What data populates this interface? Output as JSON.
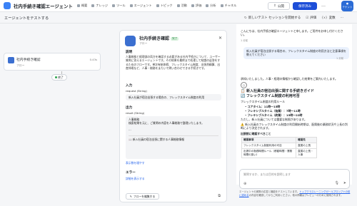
{
  "app": {
    "title": "社内手続き確認エージェント",
    "avatar_text": "テナント"
  },
  "nav": [
    "概要",
    "ナレッジ",
    "ツール",
    "エージェント",
    "トピック",
    "活動",
    "評価",
    "分析",
    "チャネル"
  ],
  "header": {
    "public_label": "公開",
    "save_label": "保存済み",
    "more": "…"
  },
  "subbar": {
    "title": "エージェントをテストする",
    "new_session": "新しいテスト セッションを開始する",
    "evaluate": "評価",
    "variables": "変数",
    "more": "…"
  },
  "flow_node": {
    "title": "社内手続き確認",
    "subtitle": "フロー",
    "time": "0.43s",
    "end_label": "終了"
  },
  "detail": {
    "title": "社内手続き確認",
    "badge": "完了",
    "subtitle": "フロー",
    "close": "✕",
    "desc_h": "説明",
    "desc": "人事総務と経理部の両方を確認する必要がある社内手続きについて、ユーザー質問に答えるエージェントです。その結果を最終まで処理して結論の返答をするためのフローです。単次有給休暇、フレックスタイム制度、出張費精算、出産休暇など、人事・総務をまたいで問い合わせできる手続きです。",
    "input_h": "入力",
    "input_label": "request (String)",
    "input_value": "新入社員が宿泊出張する場合の、フレックスタイム制度の利用",
    "output_h": "出力",
    "output_label": "result (String)",
    "output_lines": [
      "人事総務",
      "検索結果を元に、ご質問の内容を人事総務で整理いたします。",
      "…",
      "📖 新入社員の宿泊出張に関する人事総務情報"
    ],
    "more_output": "表示数を増やす",
    "error_h": "エラー",
    "error_link": "詳細を表示する",
    "edit_flow": "フローを編集する"
  },
  "chat": {
    "greeting": "こんにちは、社内手続き確認エージェントと申します。ご用件をお申し付けください。",
    "greet_time": "1 分前",
    "user_msg": "新入社員が宿泊出張する場合の、フレックスタイム制度の利用方法と注意事項を教えてください",
    "user_time": "1 分前",
    "reply_intro": "承知いたしました。人事・経理の情報から確認した結果をご案内いたします。",
    "h1": "📋 新入社員の宿泊出張に関する手続きガイド",
    "h2": "🔄 フレックスタイム制度の利用可否",
    "flex_intro": "フレックスタイム制度の利用ルール",
    "bullets": [
      "コアタイム：11時〜15時",
      "フレキシブルタイム（始業）：7時〜11時",
      "フレキシブルタイム（終業）：15時〜22時"
    ],
    "note": "ただし、新入社員については重要な制限があります。",
    "warn": "⚠️ 新入社員のフレックスタイム制度の利用開始時期は、配属後の業務状況や上長の判断により決定されます。",
    "check_h": "出張前に確認すべきこと",
    "table_head": [
      "確認事項",
      "確認先"
    ],
    "table_rows": [
      [
        "フレックスタイム制度利用の可否",
        "直属の上長"
      ],
      [
        "出張中の勤務時間ルール（移動時間・業務時間の扱い）",
        "直属の上長・人事"
      ]
    ],
    "placeholder": "質問するか、または目的を説明します",
    "disclaimer_pre": "エージェントの実際の応答と機能をテストしています。",
    "disclaimer_link": "トップクラスレーニングガールプロンプトの前に認める",
    "disclaimer_post": "の内容を確認してからご利用ください。他の情報はプレビューのために使用されます。"
  }
}
